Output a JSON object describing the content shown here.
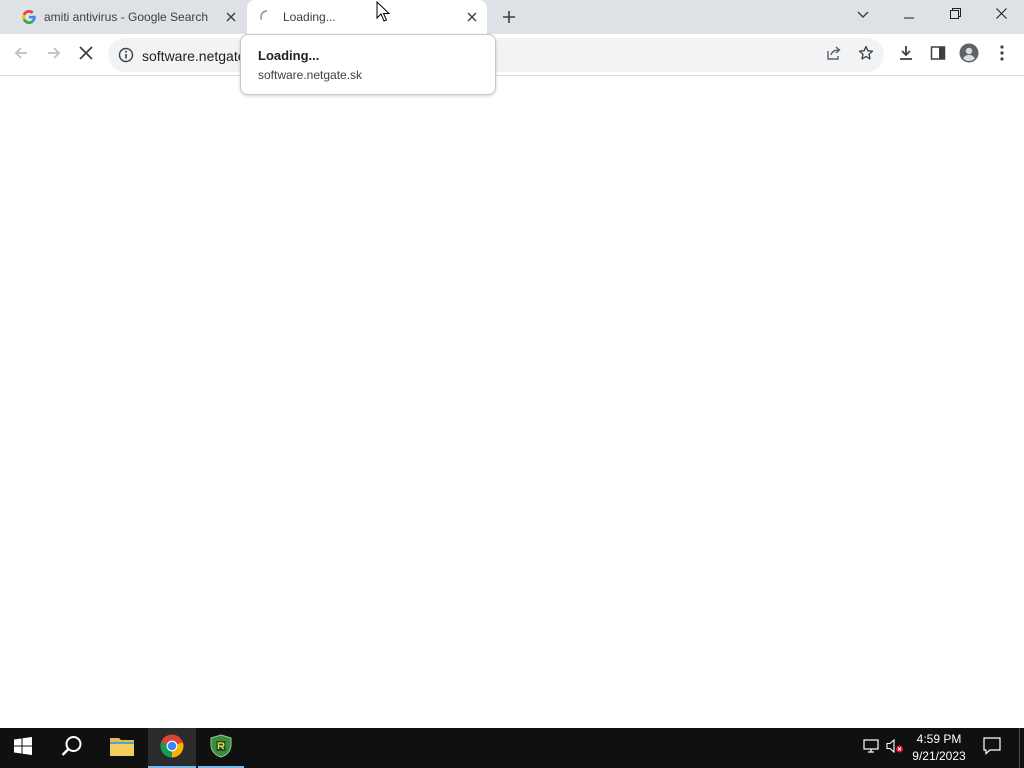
{
  "browser": {
    "tabs": [
      {
        "title": "amiti antivirus - Google Search",
        "favicon": "google-g-icon",
        "active": false
      },
      {
        "title": "Loading...",
        "favicon": "loading-spinner-icon",
        "active": true
      }
    ],
    "address_bar": {
      "url": "software.netgate"
    },
    "hover_card": {
      "title": "Loading...",
      "domain": "software.netgate.sk"
    },
    "window_controls": [
      "chevron-down-icon",
      "minimize-icon",
      "restore-icon",
      "close-icon"
    ],
    "toolbar_icons": [
      "back-icon",
      "forward-icon",
      "stop-icon",
      "info-icon",
      "share-icon",
      "star-icon",
      "download-icon",
      "side-panel-icon",
      "profile-icon",
      "menu-icon"
    ]
  },
  "taskbar": {
    "clock_time": "4:59 PM",
    "clock_date": "9/21/2023",
    "apps": [
      "windows-start-icon",
      "search-icon",
      "file-explorer-icon",
      "chrome-icon",
      "antivirus-shield-icon"
    ],
    "tray_icons": [
      "network-icon",
      "volume-muted-icon",
      "notification-icon"
    ]
  },
  "colors": {
    "tabstrip": "#dee1e6",
    "taskbar": "#101010",
    "accent": "#76b9ed"
  }
}
